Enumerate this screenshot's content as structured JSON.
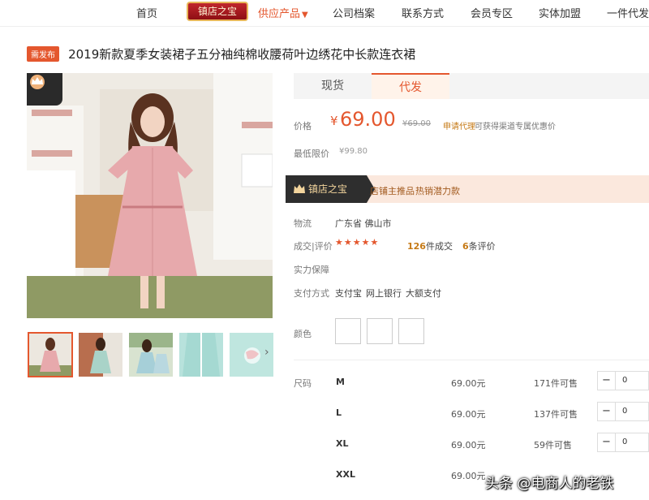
{
  "nav": {
    "home": "首页",
    "badge": "镇店之宝",
    "supply": "供应产品",
    "profile": "公司档案",
    "contact": "联系方式",
    "member": "会员专区",
    "franchise": "实体加盟",
    "dropship": "一件代发"
  },
  "product": {
    "tag": "需发布",
    "title": "2019新款夏季女装裙子五分袖纯棉收腰荷叶边绣花中长款连衣裙"
  },
  "tabs": {
    "spot": "现货",
    "dropship": "代发"
  },
  "price": {
    "label": "价格",
    "currency": "¥",
    "value": "69.00",
    "old": "¥69.00",
    "apply_link": "申请代理",
    "apply_desc": "可获得渠道专属优惠价",
    "min_label": "最低限价",
    "min_value": "¥99.80"
  },
  "banner": {
    "badge": "镇店之宝",
    "text1": "店铺主推品",
    "text2": "热销潜力款"
  },
  "info": {
    "ship_label": "物流",
    "ship_value": "广东省 佛山市",
    "deal_label": "成交|评价",
    "stars": "★★★★★",
    "deal_count": "126",
    "deal_suffix": "件成交",
    "review_count": "6",
    "review_suffix": "条评价",
    "guarantee_label": "实力保障",
    "pay_label": "支付方式",
    "pay_methods": [
      "支付宝",
      "网上银行",
      "大额支付"
    ],
    "color_label": "颜色"
  },
  "sizes": {
    "label": "尺码",
    "rows": [
      {
        "name": "M",
        "price": "69.00元",
        "stock": "171件可售",
        "qty": "0"
      },
      {
        "name": "L",
        "price": "69.00元",
        "stock": "137件可售",
        "qty": "0"
      },
      {
        "name": "XL",
        "price": "69.00元",
        "stock": "59件可售",
        "qty": "0"
      },
      {
        "name": "XXL",
        "price": "69.00元",
        "stock": "",
        "qty": ""
      }
    ]
  },
  "watermark": "头条 @电商人的老铁",
  "colors": {
    "accent": "#e4572e",
    "badge_red": "#c0262c",
    "gold": "#c67a16",
    "banner_bg": "#fbe8dd"
  }
}
